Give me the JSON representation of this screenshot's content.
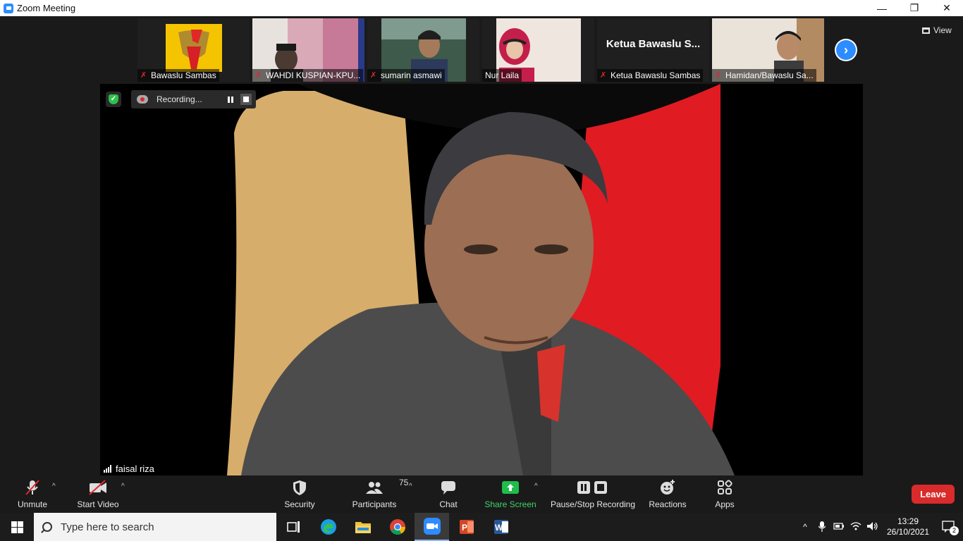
{
  "window": {
    "title": "Zoom Meeting",
    "controls": [
      "—",
      "❐",
      "✕"
    ]
  },
  "gallery": {
    "tiles": [
      {
        "name": "Bawaslu Sambas",
        "muted": true,
        "kind": "logo"
      },
      {
        "name": "WAHDI KUSPIAN-KPU...",
        "muted": true,
        "kind": "video"
      },
      {
        "name": "sumarin asmawi",
        "muted": true,
        "kind": "video"
      },
      {
        "name": "Nur Laila",
        "muted": false,
        "kind": "video"
      },
      {
        "name": "Ketua Bawaslu Sambas",
        "muted": true,
        "kind": "name",
        "display_name": "Ketua Bawaslu S..."
      },
      {
        "name": "Hamidan/Bawaslu Sa...",
        "muted": true,
        "kind": "video"
      }
    ],
    "next_icon": "chevron-right-icon",
    "view_label": "View"
  },
  "recording": {
    "label": "Recording...",
    "security_icon": "shield-check-icon"
  },
  "speaker": {
    "name": "faisal riza"
  },
  "toolbar": {
    "unmute": "Unmute",
    "start_video": "Start Video",
    "security": "Security",
    "participants": "Participants",
    "participants_count": "75",
    "chat": "Chat",
    "share_screen": "Share Screen",
    "record": "Pause/Stop Recording",
    "reactions": "Reactions",
    "apps": "Apps",
    "leave": "Leave"
  },
  "taskbar": {
    "search_placeholder": "Type here to search",
    "time": "13:29",
    "date": "26/10/2021",
    "notifications": "2",
    "apps": [
      "task-view",
      "edge",
      "file-explorer",
      "chrome",
      "zoom",
      "powerpoint",
      "word"
    ]
  },
  "colors": {
    "accent_blue": "#2d8cff",
    "leave_red": "#d92b2b",
    "share_green": "#1fbd4b",
    "mute_red": "#e02828"
  }
}
